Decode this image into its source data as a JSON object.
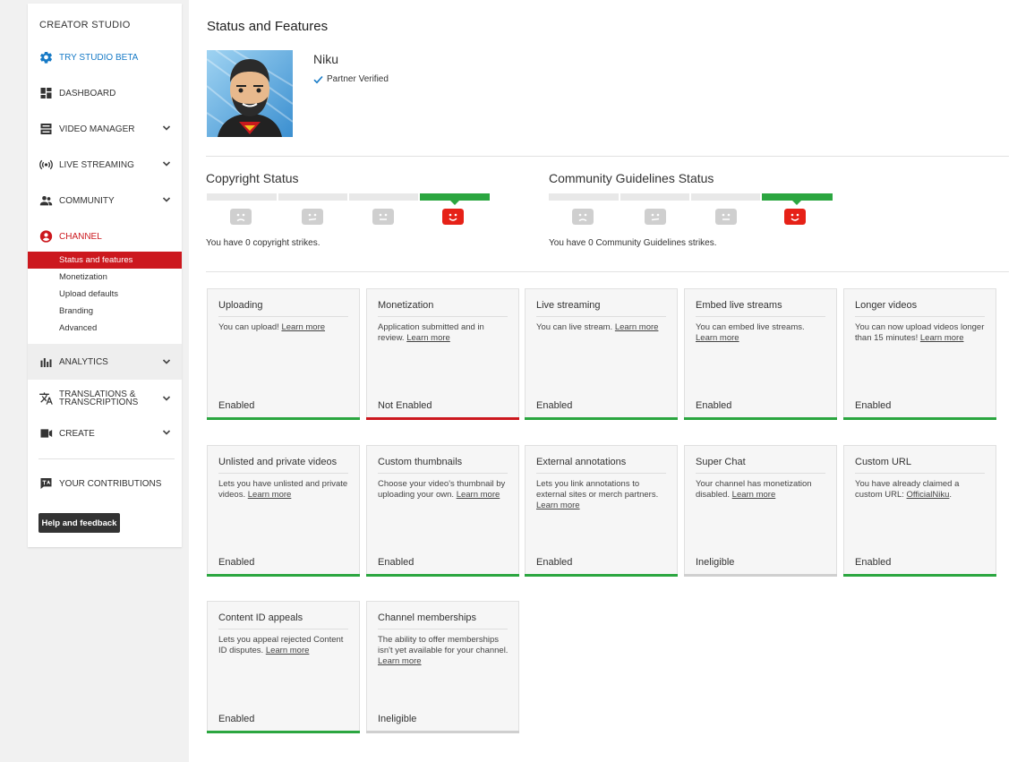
{
  "sidebar": {
    "studio_title": "CREATOR STUDIO",
    "nav": [
      {
        "label": "TRY STUDIO BETA",
        "icon": "gear-icon"
      },
      {
        "label": "DASHBOARD",
        "icon": "dashboard-icon"
      },
      {
        "label": "VIDEO MANAGER",
        "icon": "video-manager-icon"
      },
      {
        "label": "LIVE STREAMING",
        "icon": "live-streaming-icon"
      },
      {
        "label": "COMMUNITY",
        "icon": "community-icon"
      },
      {
        "label": "CHANNEL",
        "icon": "channel-icon"
      }
    ],
    "channel_sub": [
      "Status and features",
      "Monetization",
      "Upload defaults",
      "Branding",
      "Advanced"
    ],
    "nav2": [
      {
        "label": "ANALYTICS",
        "icon": "analytics-icon"
      },
      {
        "label": "TRANSLATIONS & TRANSCRIPTIONS",
        "icon": "translate-icon"
      },
      {
        "label": "CREATE",
        "icon": "create-icon"
      }
    ],
    "contributions": "YOUR CONTRIBUTIONS",
    "help": "Help and feedback"
  },
  "main": {
    "page_title": "Status and Features",
    "channel_name": "Niku",
    "partner_status": "Partner Verified",
    "copyright": {
      "title": "Copyright Status",
      "text": "You have 0 copyright strikes."
    },
    "community": {
      "title": "Community Guidelines Status",
      "text": "You have 0 Community Guidelines strikes."
    }
  },
  "cards": [
    {
      "title": "Uploading",
      "desc": "You can upload!",
      "link": "Learn more",
      "status": "Enabled",
      "state": "enabled"
    },
    {
      "title": "Monetization",
      "desc": "Application submitted and in review.",
      "link": "Learn more",
      "status": "Not Enabled",
      "state": "not-enabled"
    },
    {
      "title": "Live streaming",
      "desc": "You can live stream.",
      "link": "Learn more",
      "status": "Enabled",
      "state": "enabled"
    },
    {
      "title": "Embed live streams",
      "desc": "You can embed live streams.",
      "link": "Learn more",
      "status": "Enabled",
      "state": "enabled"
    },
    {
      "title": "Longer videos",
      "desc": "You can now upload videos longer than 15 minutes!",
      "link": "Learn more",
      "status": "Enabled",
      "state": "enabled"
    },
    {
      "title": "Unlisted and private videos",
      "desc": "Lets you have unlisted and private videos.",
      "link": "Learn more",
      "status": "Enabled",
      "state": "enabled"
    },
    {
      "title": "Custom thumbnails",
      "desc": "Choose your video's thumbnail by uploading your own.",
      "link": "Learn more",
      "status": "Enabled",
      "state": "enabled"
    },
    {
      "title": "External annotations",
      "desc": "Lets you link annotations to external sites or merch partners.",
      "link": "Learn more",
      "status": "Enabled",
      "state": "enabled"
    },
    {
      "title": "Super Chat",
      "desc": "Your channel has monetization disabled.",
      "link": "Learn more",
      "status": "Ineligible",
      "state": "ineligible"
    },
    {
      "title": "Custom URL",
      "desc": "You have already claimed a custom URL:",
      "link": "OfficialNiku",
      "suffix": ".",
      "status": "Enabled",
      "state": "enabled"
    },
    {
      "title": "Content ID appeals",
      "desc": "Lets you appeal rejected Content ID disputes.",
      "link": "Learn more",
      "status": "Enabled",
      "state": "enabled"
    },
    {
      "title": "Channel memberships",
      "desc": "The ability to offer memberships isn't yet available for your channel.",
      "link": "Learn more",
      "status": "Ineligible",
      "state": "ineligible"
    }
  ],
  "colors": {
    "red": "#cc181e",
    "green": "#2ba640",
    "blue": "#167ac6",
    "gray_bar": "#cfcfcf"
  }
}
